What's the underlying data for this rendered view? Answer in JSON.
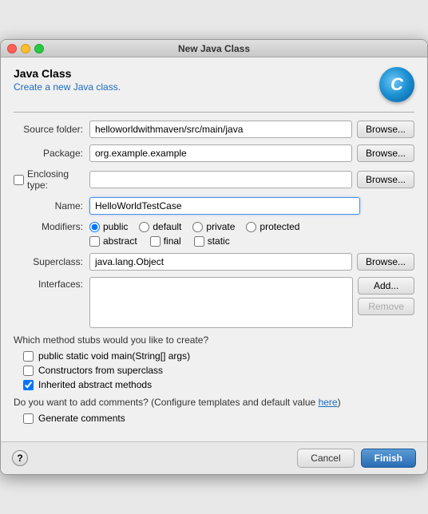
{
  "window": {
    "title": "New Java Class"
  },
  "header": {
    "title": "Java Class",
    "subtitle": "Create a new Java class.",
    "logo": "C"
  },
  "form": {
    "source_folder_label": "Source folder:",
    "source_folder_value": "helloworldwithmaven/src/main/java",
    "package_label": "Package:",
    "package_value": "org.example.example",
    "enclosing_type_label": "Enclosing type:",
    "enclosing_type_value": "",
    "name_label": "Name:",
    "name_value": "HelloWorldTestCase",
    "modifiers_label": "Modifiers:",
    "superclass_label": "Superclass:",
    "superclass_value": "java.lang.Object",
    "interfaces_label": "Interfaces:"
  },
  "modifiers": {
    "public_label": "public",
    "default_label": "default",
    "private_label": "private",
    "protected_label": "protected",
    "abstract_label": "abstract",
    "final_label": "final",
    "static_label": "static"
  },
  "buttons": {
    "browse": "Browse...",
    "add": "Add...",
    "remove": "Remove",
    "cancel": "Cancel",
    "finish": "Finish",
    "help": "?"
  },
  "stubs": {
    "title": "Which method stubs would you like to create?",
    "main_label": "public static void main(String[] args)",
    "constructors_label": "Constructors from superclass",
    "inherited_label": "Inherited abstract methods",
    "inherited_checked": true
  },
  "comments": {
    "question": "Do you want to add comments? (Configure templates and default value ",
    "here_link": "here",
    "question_end": ")",
    "generate_label": "Generate comments"
  }
}
